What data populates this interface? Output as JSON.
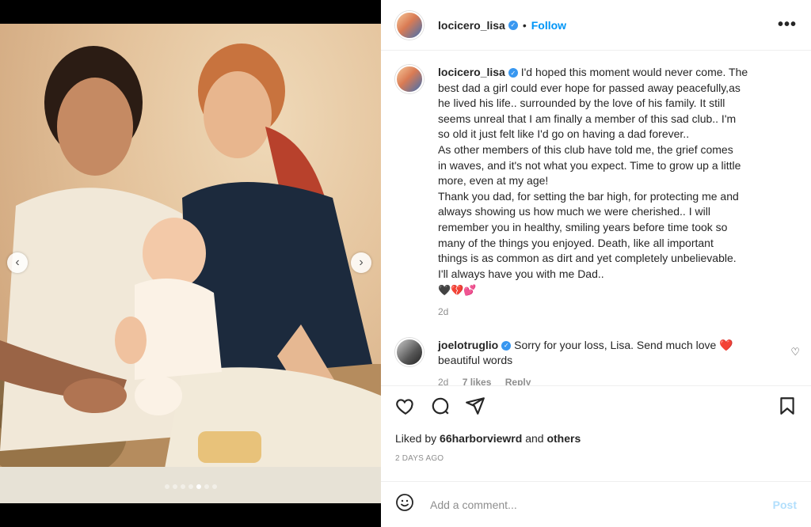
{
  "post": {
    "author": "locicero_lisa",
    "follow_label": "Follow",
    "separator": "•",
    "more_label": "•••"
  },
  "caption": {
    "username": "locicero_lisa",
    "lines": [
      "I'd hoped this moment would never come. The",
      "best dad a girl could ever hope for passed away peacefully,as",
      "he lived his life.. surrounded by the love of his family. It still",
      "seems unreal that I am finally a member of this sad club.. I'm",
      "so old it just felt like I'd go on having a dad forever..",
      "As other members of this club have told me, the grief comes",
      "in waves, and it's not what you expect. Time to grow up a little",
      "more, even at my age!",
      "Thank you dad, for setting the bar high, for protecting me and",
      "always showing us how much we were cherished.. I will",
      "remember you in healthy, smiling years before time took so",
      "many of the things you enjoyed. Death, like all important",
      "things is as common as dirt and yet completely unbelievable.",
      "I'll always have you with me Dad.."
    ],
    "emojis": "🖤💔💕",
    "time": "2d"
  },
  "comment": {
    "username": "joelotruglio",
    "text_line1": "Sorry for your loss, Lisa. Send much love ❤️",
    "text_line2": "beautiful words",
    "time": "2d",
    "likes": "7 likes",
    "reply_label": "Reply"
  },
  "likes": {
    "prefix": "Liked by",
    "user": "66harborviewrd",
    "conjunction": "and",
    "others": "others"
  },
  "posted_ago": "2 DAYS AGO",
  "add_comment": {
    "placeholder": "Add a comment...",
    "post_label": "Post"
  },
  "carousel": {
    "prev_glyph": "‹",
    "next_glyph": "›",
    "dot_count": 7,
    "active_dot": 5
  },
  "colors": {
    "accent": "#0095f6",
    "verified": "#3897f0",
    "muted": "#8e8e8e",
    "post_disabled": "#b2dffc"
  },
  "icons": [
    "heart-icon",
    "comment-icon",
    "share-icon",
    "bookmark-icon",
    "emoji-icon",
    "verified-icon",
    "more-icon"
  ]
}
